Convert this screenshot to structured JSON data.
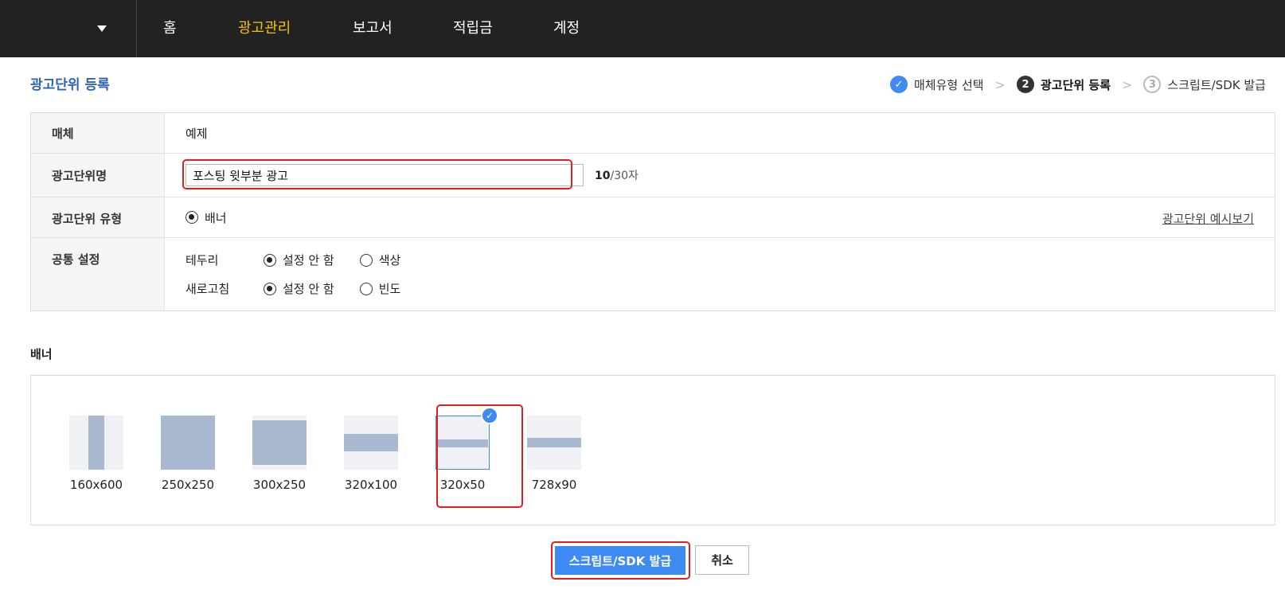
{
  "nav": {
    "items": [
      {
        "label": "홈",
        "active": false
      },
      {
        "label": "광고관리",
        "active": true
      },
      {
        "label": "보고서",
        "active": false
      },
      {
        "label": "적립금",
        "active": false
      },
      {
        "label": "계정",
        "active": false
      }
    ]
  },
  "page": {
    "title": "광고단위 등록"
  },
  "steps": [
    {
      "marker": "✓",
      "label": "매체유형 선택",
      "state": "done"
    },
    {
      "marker": "2",
      "label": "광고단위 등록",
      "state": "current"
    },
    {
      "marker": "3",
      "label": "스크립트/SDK 발급",
      "state": "todo"
    }
  ],
  "step_separator": ">",
  "form": {
    "media": {
      "label": "매체",
      "value": "예제"
    },
    "unit_name": {
      "label": "광고단위명",
      "value": "포스팅 윗부분 광고",
      "count": "10",
      "max": "/30자"
    },
    "unit_type": {
      "label": "광고단위 유형",
      "option": "배너",
      "preview_link": "광고단위 예시보기"
    },
    "common": {
      "label": "공통 설정",
      "border": {
        "label": "테두리",
        "opt1": "설정 안 함",
        "opt2": "색상"
      },
      "refresh": {
        "label": "새로고침",
        "opt1": "설정 안 함",
        "opt2": "빈도"
      }
    }
  },
  "banner": {
    "title": "배너",
    "selected": "320x50",
    "sizes": [
      "160x600",
      "250x250",
      "300x250",
      "320x100",
      "320x50",
      "728x90"
    ]
  },
  "buttons": {
    "issue": "스크립트/SDK 발급",
    "cancel": "취소"
  },
  "colors": {
    "nav_bg": "#222222",
    "nav_active": "#f2c400",
    "accent": "#3d8bf2",
    "title": "#2f64b5",
    "highlight": "#e02020"
  }
}
